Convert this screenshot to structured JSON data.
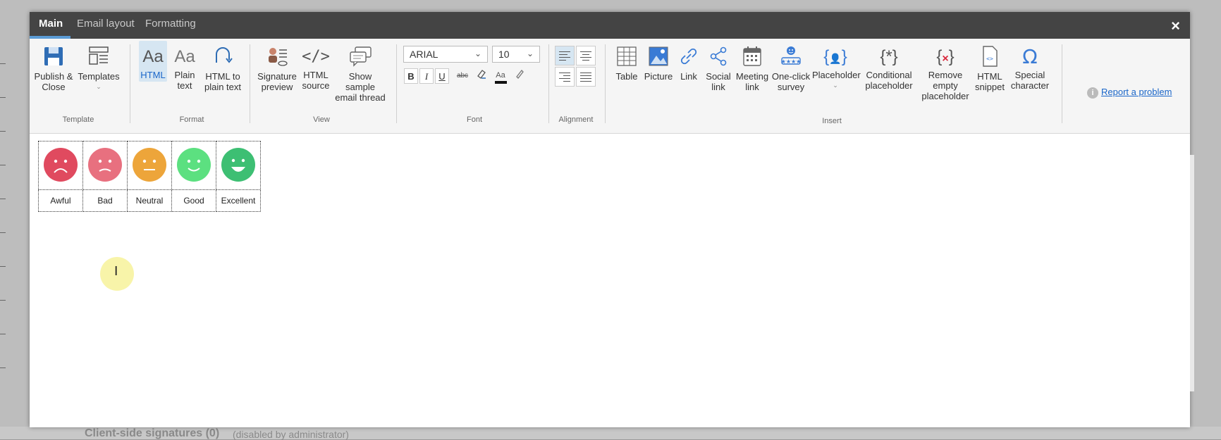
{
  "background": {
    "footer_title": "Client-side signatures (0)",
    "footer_note": "(disabled by administrator)"
  },
  "tabs": [
    {
      "label": "Main",
      "active": true
    },
    {
      "label": "Email layout",
      "active": false
    },
    {
      "label": "Formatting",
      "active": false
    }
  ],
  "close_label": "×",
  "ribbon": {
    "template": {
      "group_label": "Template",
      "publish_close": "Publish & Close",
      "templates": "Templates"
    },
    "format": {
      "group_label": "Format",
      "html": "HTML",
      "plain_text": "Plain text",
      "html_to_plain": "HTML to plain text"
    },
    "view": {
      "group_label": "View",
      "signature_preview": "Signature preview",
      "html_source": "HTML source",
      "show_sample_thread": "Show sample email thread"
    },
    "font": {
      "group_label": "Font",
      "font_family": "ARIAL",
      "font_size": "10",
      "bold": "B",
      "italic": "I",
      "underline": "U",
      "strike": "abc",
      "font_color": "Aa"
    },
    "alignment": {
      "group_label": "Alignment"
    },
    "insert": {
      "group_label": "Insert",
      "table": "Table",
      "picture": "Picture",
      "link": "Link",
      "social_link": "Social link",
      "meeting_link": "Meeting link",
      "one_click_survey": "One-click survey",
      "placeholder": "Placeholder",
      "conditional_placeholder": "Conditional placeholder",
      "remove_empty_placeholder": "Remove empty placeholder",
      "html_snippet": "HTML snippet",
      "special_character": "Special character"
    },
    "report_problem": "Report a problem"
  },
  "survey": {
    "ratings": [
      {
        "label": "Awful",
        "color": "#e04a5f"
      },
      {
        "label": "Bad",
        "color": "#e8707f"
      },
      {
        "label": "Neutral",
        "color": "#eda53a"
      },
      {
        "label": "Good",
        "color": "#5ce080"
      },
      {
        "label": "Excellent",
        "color": "#3dbf73"
      }
    ]
  },
  "colors": {
    "accent": "#5b9bd5",
    "link": "#1a66c9",
    "tabbar": "#444444"
  }
}
